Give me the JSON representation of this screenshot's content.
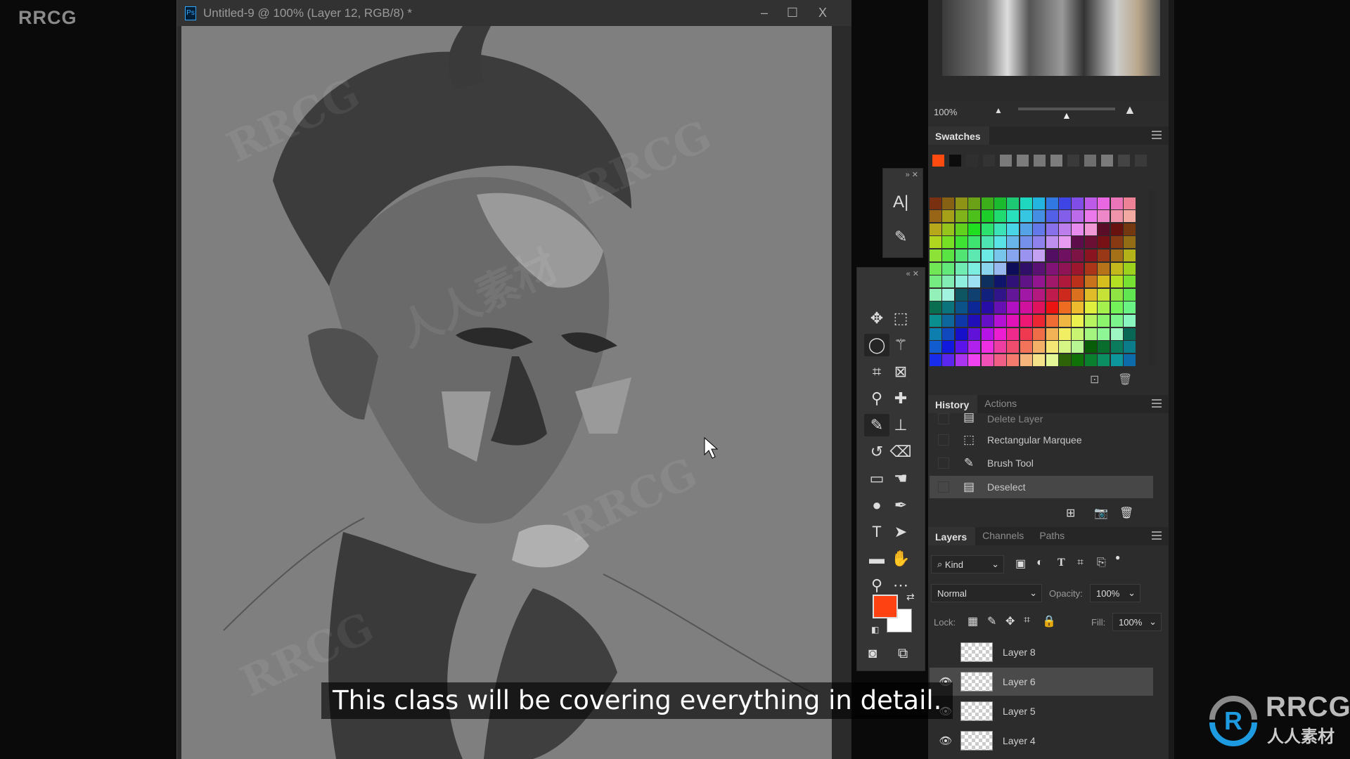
{
  "brand_watermark": "RRCG",
  "watermark_text": "RRCG",
  "watermark_cn": "人人素材",
  "document": {
    "title": "Untitled-9 @ 100% (Layer 12, RGB/8) *",
    "app_icon": "Ps",
    "minimize": "–",
    "maximize": "☐",
    "close": "X"
  },
  "mini_panel": {
    "character_icon": "A|",
    "brush_icon": "brush-settings"
  },
  "toolbar": {
    "tools": [
      "move",
      "rect-marquee",
      "lasso",
      "magic-wand",
      "crop",
      "frame",
      "eyedropper",
      "healing",
      "brush",
      "stamp",
      "history-brush",
      "eraser",
      "gradient",
      "smudge",
      "dodge",
      "pen",
      "type",
      "path-select",
      "rectangle",
      "hand",
      "zoom",
      "more"
    ],
    "selected": [
      "lasso",
      "brush"
    ],
    "foreground_color": "#ff4212",
    "background_color": "#ffffff"
  },
  "navigator": {
    "zoom": "100%"
  },
  "swatches": {
    "title": "Swatches",
    "recent": [
      "#ff4a10",
      "#0c0c0c",
      "#2f2f2f",
      "#333333",
      "#7a7a7a",
      "#7c7c7c",
      "#777777",
      "#7d7d7d",
      "#3a3a3a",
      "#6e6e6e",
      "#7a7a7a",
      "#444444",
      "#3a3a3a"
    ]
  },
  "history": {
    "tabs": [
      "History",
      "Actions"
    ],
    "items": [
      {
        "label": "Delete Layer",
        "icon": "document-icon"
      },
      {
        "label": "Rectangular Marquee",
        "icon": "marquee-icon"
      },
      {
        "label": "Brush Tool",
        "icon": "brush-icon"
      },
      {
        "label": "Deselect",
        "icon": "document-icon",
        "selected": true
      }
    ]
  },
  "layers": {
    "tabs": [
      "Layers",
      "Channels",
      "Paths"
    ],
    "filter": "Kind",
    "blend_mode": "Normal",
    "opacity_label": "Opacity:",
    "opacity": "100%",
    "lock_label": "Lock:",
    "fill_label": "Fill:",
    "fill": "100%",
    "items": [
      {
        "name": "Layer 8",
        "visible": false
      },
      {
        "name": "Layer 6",
        "visible": true,
        "selected": true
      },
      {
        "name": "Layer 5",
        "visible": true
      },
      {
        "name": "Layer 4",
        "visible": true
      }
    ]
  },
  "subtitle": "This class will be covering everything in detail.",
  "logo": {
    "text": "RRCG",
    "subtext": "人人素材",
    "color": "#1e9be0"
  }
}
